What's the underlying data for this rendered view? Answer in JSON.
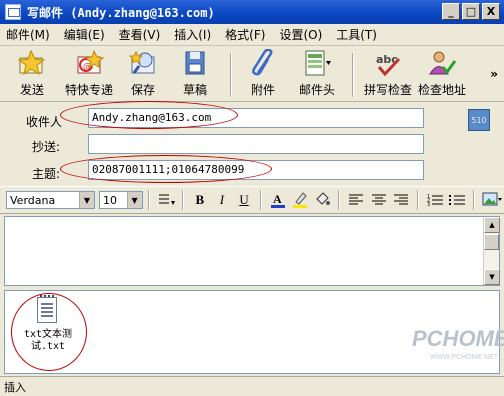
{
  "window": {
    "title": "写邮件 (Andy.zhang@163.com)",
    "minimize": "_",
    "maximize": "□",
    "close": "X"
  },
  "menu": [
    "邮件(M)",
    "编辑(E)",
    "查看(V)",
    "插入(I)",
    "格式(F)",
    "设置(O)",
    "工具(T)"
  ],
  "toolbar": {
    "send": "发送",
    "express": "特快专递",
    "save": "保存",
    "draft": "草稿",
    "attach": "附件",
    "header": "邮件头",
    "spell": "拼写检查",
    "check_addr": "检查地址",
    "more": "»"
  },
  "header": {
    "to_label": "收件人",
    "to_value": "Andy.zhang@163.com",
    "cc_label": "抄送:",
    "cc_value": "",
    "subject_label": "主题:",
    "subject_value": "02087001111;01064780099"
  },
  "format": {
    "font": "Verdana",
    "size": "10",
    "bold": "B",
    "italic": "I",
    "underline": "U"
  },
  "attachments": [
    {
      "name": "txt文本测试.txt"
    }
  ],
  "watermark": {
    "brand": "PCHOME",
    "site": "WWW.PCHOME.NET"
  },
  "status": {
    "text": "插入"
  },
  "colors": {
    "titlebar": "#0A47C2",
    "annotation": "#C00000",
    "face": "#ECE9D8"
  },
  "icons": [
    "mail-icon",
    "send-icon",
    "express-icon",
    "save-icon",
    "draft-icon",
    "paperclip-icon",
    "mail-header-icon",
    "spellcheck-icon",
    "check-address-icon",
    "address-book-icon",
    "text-file-icon"
  ]
}
